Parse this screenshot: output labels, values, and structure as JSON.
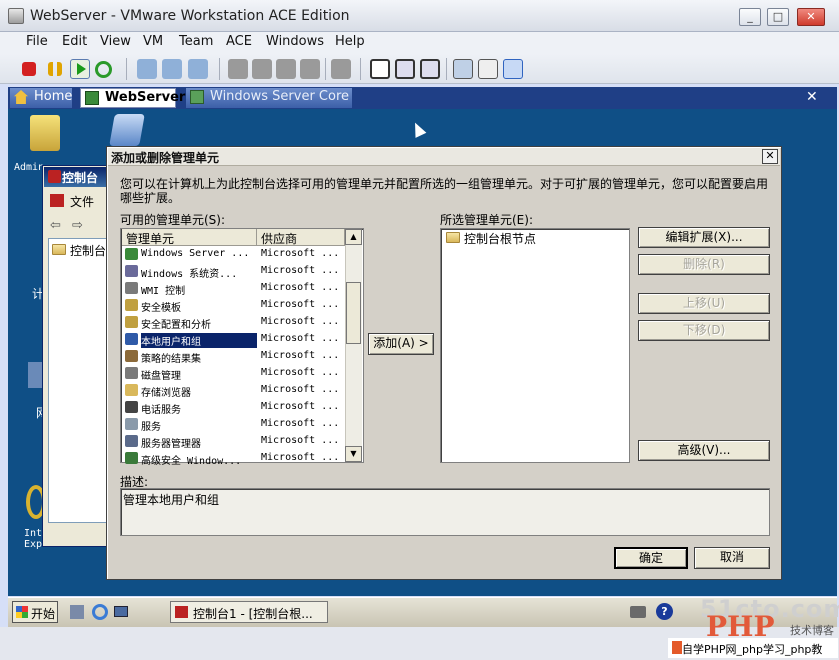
{
  "window": {
    "title": "WebServer - VMware Workstation ACE Edition"
  },
  "menu": [
    "File",
    "Edit",
    "View",
    "VM",
    "Team",
    "ACE",
    "Windows",
    "Help"
  ],
  "tabs": {
    "home": "Home",
    "webserver": "WebServer",
    "core": "Windows Server Core"
  },
  "desktop": {
    "icon1_label": "Admin",
    "icon2_label": "计",
    "icon3_label": "网",
    "ie_label": "Int\nExplor"
  },
  "mmc_bg": {
    "title": "控制台",
    "file_menu": "文件",
    "tree_node": "控制台"
  },
  "dialog": {
    "title": "添加或删除管理单元",
    "intro": "您可以在计算机上为此控制台选择可用的管理单元并配置所选的一组管理单元。对于可扩展的管理单元，您可以配置要启用哪些扩展。",
    "available_label": "可用的管理单元(S):",
    "selected_label": "所选管理单元(E):",
    "col_name": "管理单元",
    "col_vendor": "供应商",
    "snapins": [
      {
        "name": "Windows Server ...",
        "vendor": "Microsoft ...",
        "icon_color": "#3a8a3a"
      },
      {
        "name": "Windows 系统资...",
        "vendor": "Microsoft ...",
        "icon_color": "#6a6a9a"
      },
      {
        "name": "WMI 控制",
        "vendor": "Microsoft ...",
        "icon_color": "#7a7a7a"
      },
      {
        "name": "安全模板",
        "vendor": "Microsoft ...",
        "icon_color": "#c0a040"
      },
      {
        "name": "安全配置和分析",
        "vendor": "Microsoft ...",
        "icon_color": "#c0a040"
      },
      {
        "name": "本地用户和组",
        "vendor": "Microsoft ...",
        "icon_color": "#2f5aa8"
      },
      {
        "name": "策略的结果集",
        "vendor": "Microsoft ...",
        "icon_color": "#8c6a3a"
      },
      {
        "name": "磁盘管理",
        "vendor": "Microsoft ...",
        "icon_color": "#7a7a7a"
      },
      {
        "name": "存储浏览器",
        "vendor": "Microsoft ...",
        "icon_color": "#d9b85b"
      },
      {
        "name": "电话服务",
        "vendor": "Microsoft ...",
        "icon_color": "#444444"
      },
      {
        "name": "服务",
        "vendor": "Microsoft ...",
        "icon_color": "#8a9aaa"
      },
      {
        "name": "服务器管理器",
        "vendor": "Microsoft ...",
        "icon_color": "#5a6a8a"
      },
      {
        "name": "高级安全 Window...",
        "vendor": "Microsoft ...",
        "icon_color": "#3a7a3a"
      }
    ],
    "selected_index": 5,
    "add_button": "添加(A) >",
    "selected_root": "控制台根节点",
    "btn_extensions": "编辑扩展(X)...",
    "btn_remove": "删除(R)",
    "btn_move_up": "上移(U)",
    "btn_move_down": "下移(D)",
    "btn_advanced": "高级(V)...",
    "desc_label": "描述:",
    "desc_text": "管理本地用户和组",
    "btn_ok": "确定",
    "btn_cancel": "取消"
  },
  "taskbar": {
    "start": "开始",
    "task_mmc": "控制台1 - [控制台根..."
  },
  "watermark": {
    "line1": "51cto.com",
    "line2": "PHP",
    "line3": "技术博客",
    "line4": "自学PHP网_php学习_php教"
  }
}
